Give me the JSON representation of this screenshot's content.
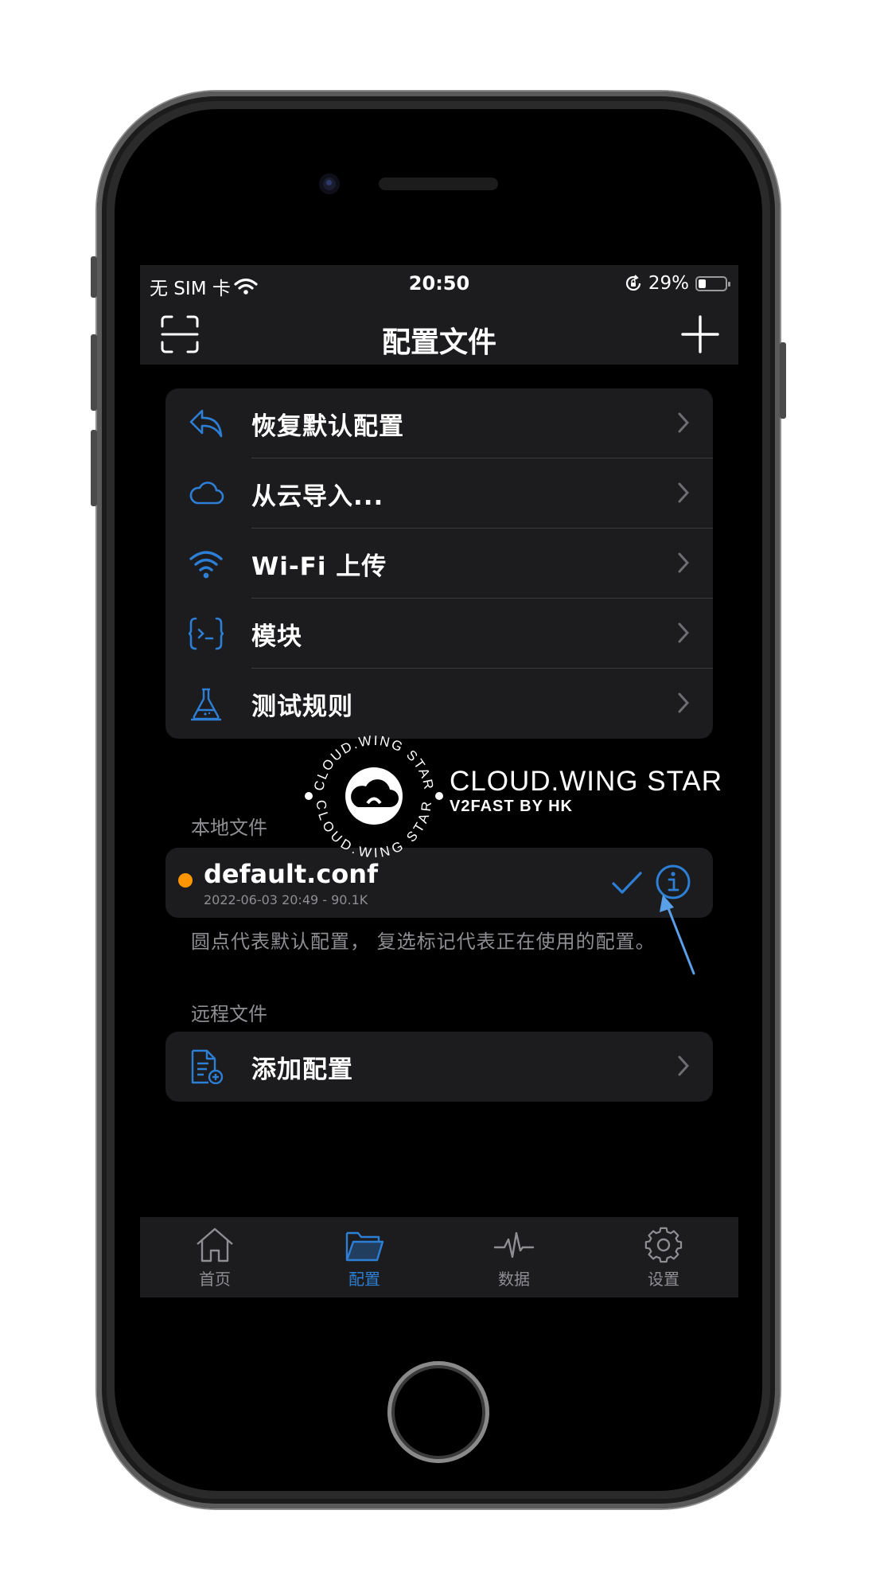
{
  "status": {
    "carrier": "无 SIM 卡",
    "time": "20:50",
    "battery": "29%",
    "battery_level": 0.29
  },
  "nav": {
    "title": "配置文件",
    "left_icon": "scan-icon",
    "right_icon": "plus-icon"
  },
  "menu": {
    "items": [
      {
        "label": "恢复默认配置",
        "icon": "restore-icon"
      },
      {
        "label": "从云导入...",
        "icon": "cloud-icon"
      },
      {
        "label": "Wi-Fi 上传",
        "icon": "wifi-icon"
      },
      {
        "label": "模块",
        "icon": "module-braces-icon"
      },
      {
        "label": "测试规则",
        "icon": "flask-icon"
      }
    ]
  },
  "local": {
    "header": "本地文件",
    "file": {
      "name": "default.conf",
      "meta": "2022-06-03 20:49 - 90.1K",
      "is_default": true,
      "in_use": true
    },
    "footnote": "圆点代表默认配置， 复选标记代表正在使用的配置。"
  },
  "remote": {
    "header": "远程文件",
    "add_label": "添加配置"
  },
  "tabs": [
    {
      "label": "首页",
      "icon": "home-icon",
      "active": false
    },
    {
      "label": "配置",
      "icon": "folder-icon",
      "active": true
    },
    {
      "label": "数据",
      "icon": "activity-icon",
      "active": false
    },
    {
      "label": "设置",
      "icon": "gear-icon",
      "active": false
    }
  ],
  "watermark": {
    "brand": "CLOUD.WING STAR",
    "sub": "V2FAST BY HK",
    "ring_text": "CLOUD.WING STAR"
  },
  "colors": {
    "accent": "#2d7fd6",
    "default_dot": "#ff9500",
    "cell_bg": "#1c1c1e",
    "secondary_text": "#8e8e93"
  }
}
